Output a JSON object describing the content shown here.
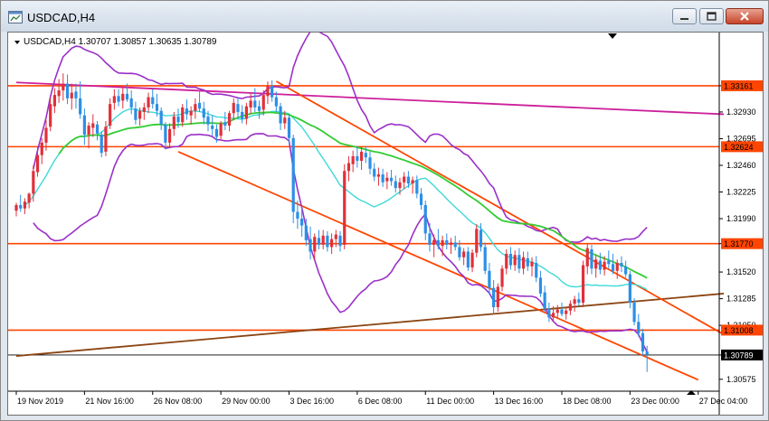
{
  "window": {
    "title": "USDCAD,H4",
    "minimize_icon": "minimize-icon",
    "maximize_icon": "maximize-icon",
    "close_icon": "close-icon"
  },
  "chart_data": {
    "type": "candlestick",
    "symbol_header": "USDCAD,H4  1.30707 1.30857 1.30635 1.30789",
    "timeframe": "H4",
    "ylim": [
      1.3047,
      1.3363
    ],
    "price_ticks": [
      "1.33161",
      "1.32930",
      "1.32695",
      "1.32460",
      "1.32225",
      "1.31990",
      "1.31770",
      "1.31520",
      "1.31285",
      "1.31050",
      "1.30789",
      "1.30575"
    ],
    "price_tick_values": [
      1.33161,
      1.3293,
      1.32695,
      1.3246,
      1.32225,
      1.3199,
      1.3177,
      1.3152,
      1.31285,
      1.3105,
      1.30789,
      1.30575
    ],
    "highlighted_price_labels": [
      {
        "label": "1.33161",
        "value": 1.33161,
        "color": "#ff4500"
      },
      {
        "label": "1.32624",
        "value": 1.32624,
        "color": "#ff4500"
      },
      {
        "label": "1.31770",
        "value": 1.3177,
        "color": "#ff4500"
      },
      {
        "label": "1.31008",
        "value": 1.31008,
        "color": "#ff4500"
      }
    ],
    "current_price": {
      "label": "1.30789",
      "value": 1.30789
    },
    "time_labels": [
      "19 Nov 2019",
      "21 Nov 16:00",
      "26 Nov 08:00",
      "29 Nov 00:00",
      "3 Dec 16:00",
      "6 Dec 08:00",
      "11 Dec 00:00",
      "13 Dec 16:00",
      "18 Dec 08:00",
      "23 Dec 00:00",
      "27 Dec 04:00"
    ],
    "time_label_slots": [
      0,
      16,
      32,
      48,
      64,
      80,
      96,
      112,
      128,
      144,
      160
    ],
    "slot_count": 166,
    "horizontal_levels": [
      {
        "value": 1.33161,
        "color": "#ff4500"
      },
      {
        "value": 1.32624,
        "color": "#ff4500"
      },
      {
        "value": 1.3177,
        "color": "#ff4500"
      },
      {
        "value": 1.31008,
        "color": "#ff4500"
      }
    ],
    "trend_lines": [
      {
        "name": "purple-resistance",
        "color": "#cc1f9a",
        "from": [
          0,
          1.3319
        ],
        "to": [
          166,
          1.3291
        ]
      },
      {
        "name": "brown-support",
        "color": "#8b4513",
        "from": [
          0,
          1.3078
        ],
        "to": [
          166,
          1.3133
        ]
      },
      {
        "name": "channel-upper",
        "color": "#ff4500",
        "from": [
          61,
          1.332
        ],
        "to": [
          166,
          1.3097
        ]
      },
      {
        "name": "channel-lower",
        "color": "#ff4500",
        "from": [
          38,
          1.3258
        ],
        "to": [
          160,
          1.3057
        ]
      }
    ],
    "colors": {
      "bull": "#e0303a",
      "bear": "#2b8fe6",
      "bollinger": "#9b30c8",
      "ma_slow": "#33cc33",
      "ma_fast": "#40d8d8"
    },
    "ohlc_series": [
      {
        "from": 0,
        "ohlc": [
          [
            1.3206,
            1.3213,
            1.3201,
            1.3211
          ],
          [
            1.3211,
            1.322,
            1.3205,
            1.3208
          ],
          [
            1.3208,
            1.3217,
            1.3203,
            1.3214
          ],
          [
            1.3213,
            1.3222,
            1.3208,
            1.3221
          ],
          [
            1.3221,
            1.3246,
            1.3214,
            1.3241
          ],
          [
            1.324,
            1.3262,
            1.3236,
            1.3255
          ],
          [
            1.3255,
            1.327,
            1.3247,
            1.3266
          ],
          [
            1.3266,
            1.3286,
            1.3259,
            1.3279
          ],
          [
            1.328,
            1.3306,
            1.3276,
            1.33
          ],
          [
            1.3298,
            1.3314,
            1.3292,
            1.3308
          ],
          [
            1.3307,
            1.3322,
            1.3301,
            1.3312
          ],
          [
            1.3312,
            1.3327,
            1.3303,
            1.3318
          ],
          [
            1.3318,
            1.3326,
            1.33,
            1.3305
          ],
          [
            1.3305,
            1.3318,
            1.3295,
            1.331
          ],
          [
            1.3311,
            1.3318,
            1.3296,
            1.3305
          ],
          [
            1.3305,
            1.332,
            1.3287,
            1.3291
          ],
          [
            1.329,
            1.3296,
            1.3264,
            1.3273
          ],
          [
            1.3273,
            1.3284,
            1.3261,
            1.3281
          ],
          [
            1.3279,
            1.3291,
            1.3271,
            1.3283
          ],
          [
            1.3282,
            1.3285,
            1.3268,
            1.3274
          ],
          [
            1.3273,
            1.3276,
            1.3253,
            1.3257
          ],
          [
            1.3258,
            1.3285,
            1.3254,
            1.328
          ],
          [
            1.3281,
            1.3305,
            1.3278,
            1.33
          ],
          [
            1.3301,
            1.3313,
            1.3295,
            1.3307
          ],
          [
            1.3307,
            1.3313,
            1.3298,
            1.3302
          ],
          [
            1.3303,
            1.3314,
            1.3296,
            1.3309
          ],
          [
            1.3309,
            1.3318,
            1.3302,
            1.3304
          ],
          [
            1.3305,
            1.3312,
            1.3291,
            1.3297
          ],
          [
            1.3296,
            1.3302,
            1.3282,
            1.3286
          ],
          [
            1.3287,
            1.3297,
            1.3281,
            1.3294
          ],
          [
            1.3293,
            1.3301,
            1.3286,
            1.3297
          ],
          [
            1.3297,
            1.331,
            1.3292,
            1.3306
          ],
          [
            1.3306,
            1.3313,
            1.3296,
            1.33
          ],
          [
            1.33,
            1.3309,
            1.3289,
            1.3294
          ],
          [
            1.3294,
            1.3297,
            1.3277,
            1.3282
          ],
          [
            1.3282,
            1.3284,
            1.326,
            1.3266
          ],
          [
            1.3266,
            1.3283,
            1.3262,
            1.3278
          ],
          [
            1.3278,
            1.3293,
            1.3272,
            1.3289
          ],
          [
            1.3289,
            1.3296,
            1.3279,
            1.3284
          ],
          [
            1.3284,
            1.33,
            1.328,
            1.3297
          ],
          [
            1.3296,
            1.3304,
            1.3286,
            1.3291
          ],
          [
            1.329,
            1.3298,
            1.3282,
            1.3294
          ],
          [
            1.3294,
            1.3305,
            1.3287,
            1.33
          ],
          [
            1.3301,
            1.3312,
            1.3293,
            1.3296
          ],
          [
            1.3296,
            1.3302,
            1.3282,
            1.3288
          ],
          [
            1.3289,
            1.3294,
            1.3276,
            1.3282
          ],
          [
            1.3281,
            1.329,
            1.3272,
            1.3278
          ],
          [
            1.3278,
            1.3282,
            1.3266,
            1.3271
          ],
          [
            1.3272,
            1.3285,
            1.3268,
            1.3283
          ],
          [
            1.3284,
            1.3293,
            1.3277,
            1.3281
          ],
          [
            1.3281,
            1.3294,
            1.3276,
            1.3292
          ],
          [
            1.3292,
            1.3305,
            1.3286,
            1.3301
          ],
          [
            1.33,
            1.3306,
            1.3287,
            1.3293
          ],
          [
            1.3293,
            1.3299,
            1.3283,
            1.3287
          ],
          [
            1.3287,
            1.3301,
            1.3282,
            1.3298
          ],
          [
            1.3297,
            1.331,
            1.3291,
            1.3303
          ],
          [
            1.3303,
            1.3314,
            1.3293,
            1.3297
          ],
          [
            1.3298,
            1.3303,
            1.3287,
            1.3294
          ],
          [
            1.3295,
            1.3312,
            1.329,
            1.3308
          ],
          [
            1.3307,
            1.332,
            1.33,
            1.3316
          ],
          [
            1.3316,
            1.3321,
            1.3302,
            1.3306
          ],
          [
            1.3306,
            1.3311,
            1.3293,
            1.3298
          ],
          [
            1.3298,
            1.3301,
            1.3277,
            1.3283
          ],
          [
            1.3283,
            1.3294,
            1.3278,
            1.3288
          ],
          [
            1.3288,
            1.3291,
            1.3265,
            1.327
          ],
          [
            1.327,
            1.3273,
            1.3195,
            1.3205
          ],
          [
            1.3205,
            1.3215,
            1.319,
            1.3199
          ],
          [
            1.3199,
            1.321,
            1.3183,
            1.3193
          ],
          [
            1.3193,
            1.3199,
            1.3175,
            1.318
          ],
          [
            1.3181,
            1.3192,
            1.3163,
            1.317
          ],
          [
            1.317,
            1.3186,
            1.3163,
            1.3183
          ],
          [
            1.3182,
            1.3189,
            1.3172,
            1.3176
          ],
          [
            1.3176,
            1.3189,
            1.3172,
            1.3184
          ],
          [
            1.3184,
            1.3188,
            1.317,
            1.3174
          ],
          [
            1.3174,
            1.3186,
            1.3168,
            1.3181
          ],
          [
            1.3181,
            1.3189,
            1.3174,
            1.3185
          ],
          [
            1.3184,
            1.3188,
            1.317,
            1.3175
          ],
          [
            1.3176,
            1.3247,
            1.3172,
            1.3241
          ],
          [
            1.3241,
            1.3254,
            1.3232,
            1.3248
          ],
          [
            1.3247,
            1.3259,
            1.324,
            1.3254
          ],
          [
            1.3254,
            1.3263,
            1.3244,
            1.325
          ],
          [
            1.325,
            1.3262,
            1.3242,
            1.3258
          ],
          [
            1.3257,
            1.3263,
            1.3248,
            1.3253
          ],
          [
            1.3253,
            1.3258,
            1.3238,
            1.3243
          ],
          [
            1.3243,
            1.3248,
            1.3232,
            1.3236
          ],
          [
            1.3236,
            1.3244,
            1.3228,
            1.3238
          ],
          [
            1.3238,
            1.3243,
            1.3227,
            1.3231
          ],
          [
            1.3232,
            1.324,
            1.3225,
            1.3235
          ],
          [
            1.3235,
            1.3242,
            1.3228,
            1.3232
          ],
          [
            1.3232,
            1.3237,
            1.3222,
            1.3226
          ],
          [
            1.3226,
            1.3235,
            1.322,
            1.3231
          ],
          [
            1.3231,
            1.324,
            1.3225,
            1.3236
          ],
          [
            1.3236,
            1.3241,
            1.3226,
            1.323
          ],
          [
            1.323,
            1.3236,
            1.3221,
            1.3233
          ],
          [
            1.3233,
            1.3237,
            1.3217,
            1.3221
          ],
          [
            1.3221,
            1.3226,
            1.3207,
            1.3211
          ],
          [
            1.3211,
            1.3215,
            1.318,
            1.3186
          ],
          [
            1.3186,
            1.3195,
            1.317,
            1.3176
          ],
          [
            1.3176,
            1.3185,
            1.3165,
            1.318
          ],
          [
            1.318,
            1.319,
            1.3172,
            1.3175
          ],
          [
            1.3175,
            1.3184,
            1.3166,
            1.318
          ],
          [
            1.318,
            1.3186,
            1.3172,
            1.3176
          ],
          [
            1.3176,
            1.3182,
            1.3168,
            1.3178
          ],
          [
            1.3178,
            1.3184,
            1.3171,
            1.3174
          ],
          [
            1.3174,
            1.318,
            1.3162,
            1.3165
          ],
          [
            1.3165,
            1.3173,
            1.3158,
            1.317
          ],
          [
            1.317,
            1.3174,
            1.3153,
            1.3156
          ],
          [
            1.3156,
            1.3172,
            1.3152,
            1.3169
          ],
          [
            1.3169,
            1.3194,
            1.3165,
            1.319
          ],
          [
            1.3189,
            1.3195,
            1.317,
            1.3174
          ],
          [
            1.3174,
            1.3178,
            1.315,
            1.3153
          ],
          [
            1.3153,
            1.316,
            1.3132,
            1.3138
          ],
          [
            1.3138,
            1.3145,
            1.3115,
            1.3121
          ],
          [
            1.3121,
            1.3142,
            1.3117,
            1.3139
          ],
          [
            1.3139,
            1.3158,
            1.3135,
            1.3155
          ],
          [
            1.3155,
            1.3172,
            1.315,
            1.3168
          ],
          [
            1.3168,
            1.3174,
            1.3154,
            1.3158
          ],
          [
            1.3158,
            1.3171,
            1.3153,
            1.3167
          ],
          [
            1.3167,
            1.3173,
            1.3151,
            1.3155
          ],
          [
            1.3155,
            1.317,
            1.315,
            1.3165
          ],
          [
            1.3164,
            1.317,
            1.3153,
            1.3157
          ],
          [
            1.3157,
            1.3165,
            1.3148,
            1.3161
          ],
          [
            1.316,
            1.3166,
            1.3143,
            1.3147
          ],
          [
            1.3147,
            1.3153,
            1.313,
            1.3133
          ],
          [
            1.3134,
            1.314,
            1.3117,
            1.312
          ],
          [
            1.312,
            1.3125,
            1.3108,
            1.3112
          ],
          [
            1.3112,
            1.3122,
            1.3108,
            1.3116
          ],
          [
            1.3116,
            1.3123,
            1.3111,
            1.3119
          ],
          [
            1.3119,
            1.3125,
            1.3113,
            1.3115
          ],
          [
            1.3115,
            1.3121,
            1.311,
            1.3118
          ],
          [
            1.3118,
            1.3127,
            1.3114,
            1.3124
          ],
          [
            1.3124,
            1.3131,
            1.3117,
            1.3128
          ],
          [
            1.3128,
            1.3134,
            1.3122,
            1.3125
          ],
          [
            1.3125,
            1.3162,
            1.3121,
            1.3158
          ],
          [
            1.3157,
            1.3177,
            1.315,
            1.3173
          ],
          [
            1.3172,
            1.3176,
            1.315,
            1.3155
          ],
          [
            1.3155,
            1.3167,
            1.3147,
            1.3163
          ],
          [
            1.3162,
            1.3169,
            1.315,
            1.3154
          ],
          [
            1.3154,
            1.3166,
            1.3149,
            1.3161
          ],
          [
            1.3162,
            1.3171,
            1.3155,
            1.3159
          ],
          [
            1.3159,
            1.3168,
            1.315,
            1.3153
          ],
          [
            1.3153,
            1.3163,
            1.3146,
            1.316
          ],
          [
            1.316,
            1.3166,
            1.3152,
            1.3157
          ],
          [
            1.3157,
            1.3162,
            1.3147,
            1.315
          ],
          [
            1.315,
            1.3153,
            1.312,
            1.3125
          ],
          [
            1.3125,
            1.3129,
            1.3105,
            1.3108
          ],
          [
            1.3108,
            1.3115,
            1.3095,
            1.3098
          ],
          [
            1.3098,
            1.3102,
            1.3078,
            1.3082
          ],
          [
            1.3082,
            1.3087,
            1.3064,
            1.3079
          ]
        ]
      }
    ]
  }
}
